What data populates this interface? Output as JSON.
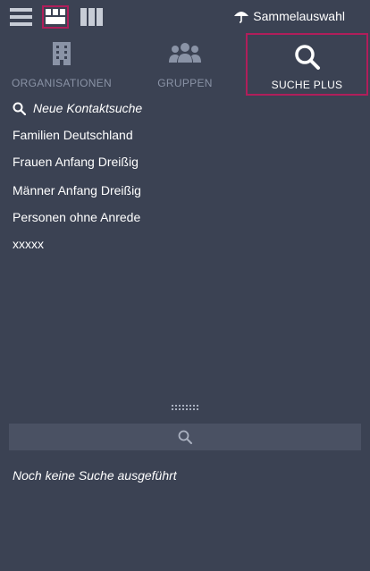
{
  "toolbar": {
    "view_modes": [
      "list-view",
      "grid-view",
      "column-view"
    ],
    "sammel_label": "Sammelauswahl"
  },
  "tabs": [
    {
      "label": "ORGANISATIONEN",
      "icon": "building-icon",
      "active": false
    },
    {
      "label": "GRUPPEN",
      "icon": "group-icon",
      "active": false
    },
    {
      "label": "SUCHE PLUS",
      "icon": "search-icon",
      "active": true
    }
  ],
  "list": {
    "new_search_label": "Neue Kontaktsuche",
    "items": [
      "Familien Deutschland",
      "Frauen Anfang Dreißig",
      "Männer Anfang Dreißig",
      "Personen ohne Anrede",
      "xxxxx"
    ]
  },
  "results": {
    "status_text": "Noch keine Suche ausgeführt"
  },
  "colors": {
    "background": "#3b4253",
    "accent_border": "#b01e5a",
    "inactive_text": "#8a93a6",
    "searchbar_bg": "#4a5163"
  }
}
